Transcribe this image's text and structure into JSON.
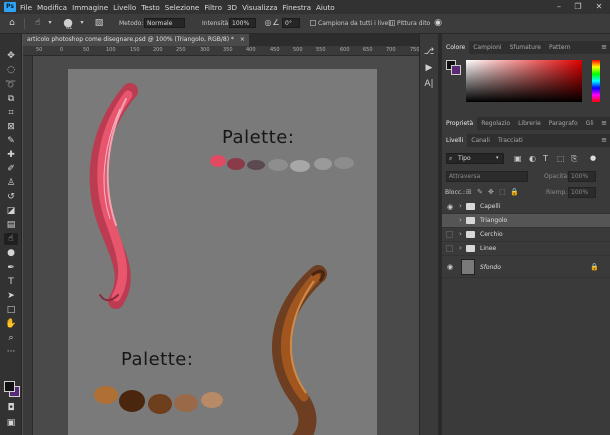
{
  "app": {
    "logo": "Ps",
    "menu": [
      "File",
      "Modifica",
      "Immagine",
      "Livello",
      "Testo",
      "Selezione",
      "Filtro",
      "3D",
      "Visualizza",
      "Finestra",
      "Aiuto"
    ],
    "window_controls": {
      "minimize": "–",
      "restore": "❐",
      "close": "✕"
    }
  },
  "options": {
    "brush_size": "61",
    "mode_label": "Metodo:",
    "mode_value": "Normale",
    "intensity_label": "Intensità:",
    "intensity_value": "100%",
    "angle_value": "0°",
    "sample_all_label": "Campiona da tutti i livelli",
    "finger_paint_label": "Pittura dito"
  },
  "document": {
    "tab_title": "articolo photoshop come disegnare.psd @ 100% (Triangolo, RGB/8) *",
    "close": "×",
    "ruler_h": [
      "50",
      "0",
      "50",
      "100",
      "150",
      "200",
      "250",
      "300",
      "350",
      "400",
      "450",
      "500",
      "550",
      "600",
      "650",
      "700",
      "750"
    ],
    "canvas_texts": {
      "palette_top": "Palette:",
      "palette_bottom": "Palette:"
    }
  },
  "colors": {
    "accent": "#2fa3f6",
    "foreground": "#111111",
    "background": "#5a2a78",
    "red_stroke": "#e0405a",
    "brown_stroke": "#8a4a1c"
  },
  "color_panel": {
    "tabs": [
      "Colore",
      "Campioni",
      "Sfumature",
      "Pattern"
    ],
    "active_tab": "Colore"
  },
  "props_panel": {
    "tabs": [
      "Proprietà",
      "Regolazio",
      "Librerie",
      "Paragrafo",
      "Gli"
    ],
    "active_tab": "Proprietà"
  },
  "layers_panel": {
    "tabs": [
      "Livelli",
      "Canali",
      "Tracciati"
    ],
    "active_tab": "Livelli",
    "filter_label": "Tipo",
    "blend_mode": "Attraversa",
    "opacity_label": "Opacità:",
    "opacity_value": "100%",
    "lock_label": "Blocc.:",
    "fill_label": "Riemp.:",
    "fill_value": "100%",
    "layers": [
      {
        "name": "Capelli",
        "type": "group",
        "selected": false,
        "visible": true
      },
      {
        "name": "Triangolo",
        "type": "group",
        "selected": true,
        "visible": false
      },
      {
        "name": "Cerchio",
        "type": "group",
        "selected": false,
        "visible": false
      },
      {
        "name": "Linee",
        "type": "group",
        "selected": false,
        "visible": false
      },
      {
        "name": "Sfondo",
        "type": "background",
        "selected": false,
        "visible": true
      }
    ]
  }
}
